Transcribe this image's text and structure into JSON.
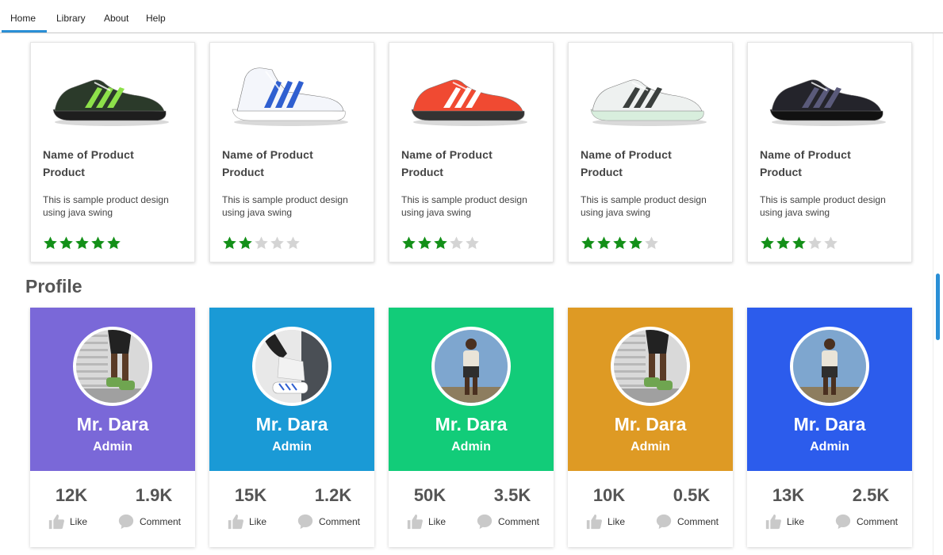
{
  "menu": {
    "items": [
      {
        "label": "Home"
      },
      {
        "label": "Library"
      },
      {
        "label": "About"
      },
      {
        "label": "Help"
      }
    ]
  },
  "products": [
    {
      "name": "Name of Product",
      "subtitle": "Product",
      "description": "This is sample product design using java swing",
      "rating": 5,
      "rating_max": 5,
      "shoe": "black-green-running-shoe-icon",
      "colors": {
        "body": "#2b3a2a",
        "accent": "#8de14a",
        "sole": "#1e1e1e"
      }
    },
    {
      "name": "Name of Product",
      "subtitle": "Product",
      "description": "This is sample product design using java swing",
      "rating": 2,
      "rating_max": 5,
      "shoe": "white-blue-high-top-shoe-icon",
      "colors": {
        "body": "#f4f6fb",
        "accent": "#2f5fd0",
        "sole": "#ffffff"
      }
    },
    {
      "name": "Name of Product",
      "subtitle": "Product",
      "description": "This is sample product design using java swing",
      "rating": 3,
      "rating_max": 5,
      "shoe": "red-running-shoe-icon",
      "colors": {
        "body": "#f04a32",
        "accent": "#ffffff",
        "sole": "#333333"
      }
    },
    {
      "name": "Name of Product",
      "subtitle": "Product",
      "description": "This is sample product design using java swing",
      "rating": 4,
      "rating_max": 5,
      "shoe": "white-running-shoe-icon",
      "colors": {
        "body": "#eef1f0",
        "accent": "#3a3f3d",
        "sole": "#d8eedd"
      }
    },
    {
      "name": "Name of Product",
      "subtitle": "Product",
      "description": "This is sample product design using java swing",
      "rating": 3,
      "rating_max": 5,
      "shoe": "black-purple-running-shoe-icon",
      "colors": {
        "body": "#24242b",
        "accent": "#5a5a7a",
        "sole": "#111111"
      }
    }
  ],
  "profile_section": {
    "title": "Profile"
  },
  "profiles": [
    {
      "name": "Mr. Dara",
      "role": "Admin",
      "likes": "12K",
      "comments": "1.9K",
      "like_label": "Like",
      "comment_label": "Comment",
      "color": "#7a68d8",
      "avatar": "legs-sneakers-avatar-icon"
    },
    {
      "name": "Mr. Dara",
      "role": "Admin",
      "likes": "15K",
      "comments": "1.2K",
      "like_label": "Like",
      "comment_label": "Comment",
      "color": "#1a9ad6",
      "avatar": "tying-shoes-avatar-icon"
    },
    {
      "name": "Mr. Dara",
      "role": "Admin",
      "likes": "50K",
      "comments": "3.5K",
      "like_label": "Like",
      "comment_label": "Comment",
      "color": "#12cc79",
      "avatar": "man-standing-avatar-icon"
    },
    {
      "name": "Mr. Dara",
      "role": "Admin",
      "likes": "10K",
      "comments": "0.5K",
      "like_label": "Like",
      "comment_label": "Comment",
      "color": "#de9a24",
      "avatar": "legs-sneakers-avatar-icon"
    },
    {
      "name": "Mr. Dara",
      "role": "Admin",
      "likes": "13K",
      "comments": "2.5K",
      "like_label": "Like",
      "comment_label": "Comment",
      "color": "#2c5cec",
      "avatar": "man-standing-avatar-icon"
    }
  ],
  "colors": {
    "star_filled": "#139018",
    "star_empty": "#d4d4d4",
    "accent": "#2a8fd6",
    "icon_gray": "#c9c9c9"
  }
}
